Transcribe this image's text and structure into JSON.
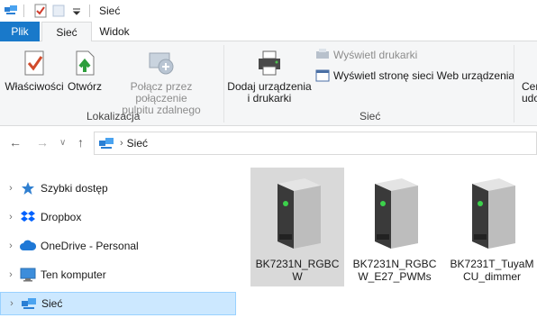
{
  "window": {
    "title": "Sieć"
  },
  "tabs": [
    {
      "label": "Plik"
    },
    {
      "label": "Sieć"
    },
    {
      "label": "Widok"
    }
  ],
  "ribbon": {
    "location_group": {
      "label": "Lokalizacja",
      "properties": "Właściwości",
      "open": "Otwórz",
      "remote_line1": "Połącz przez połączenie",
      "remote_line2": "pulpitu zdalnego"
    },
    "network_group": {
      "label": "Sieć",
      "add_line1": "Dodaj urządzenia",
      "add_line2": "i drukarki",
      "show_printers": "Wyświetl drukarki",
      "show_webpage": "Wyświetl stronę sieci Web urządzenia"
    },
    "cut_off": {
      "line1": "Cer",
      "line2": "udo"
    }
  },
  "address": {
    "crumb": "Sieć"
  },
  "navpane": {
    "items": [
      {
        "label": "Szybki dostęp",
        "icon": "star-icon"
      },
      {
        "label": "Dropbox",
        "icon": "dropbox-icon"
      },
      {
        "label": "OneDrive - Personal",
        "icon": "cloud-icon"
      },
      {
        "label": "Ten komputer",
        "icon": "computer-icon"
      },
      {
        "label": "Sieć",
        "icon": "network-icon"
      }
    ]
  },
  "devices": [
    {
      "line1": "BK7231N_RGBC",
      "line2": "W",
      "selected": true
    },
    {
      "line1": "BK7231N_RGBC",
      "line2": "W_E27_PWMs",
      "selected": false
    },
    {
      "line1": "BK7231T_TuyaM",
      "line2": "CU_dimmer",
      "selected": false
    }
  ],
  "colors": {
    "accent": "#1979ca",
    "selection": "#cce8ff",
    "tile_selected": "#d9d9d9"
  }
}
